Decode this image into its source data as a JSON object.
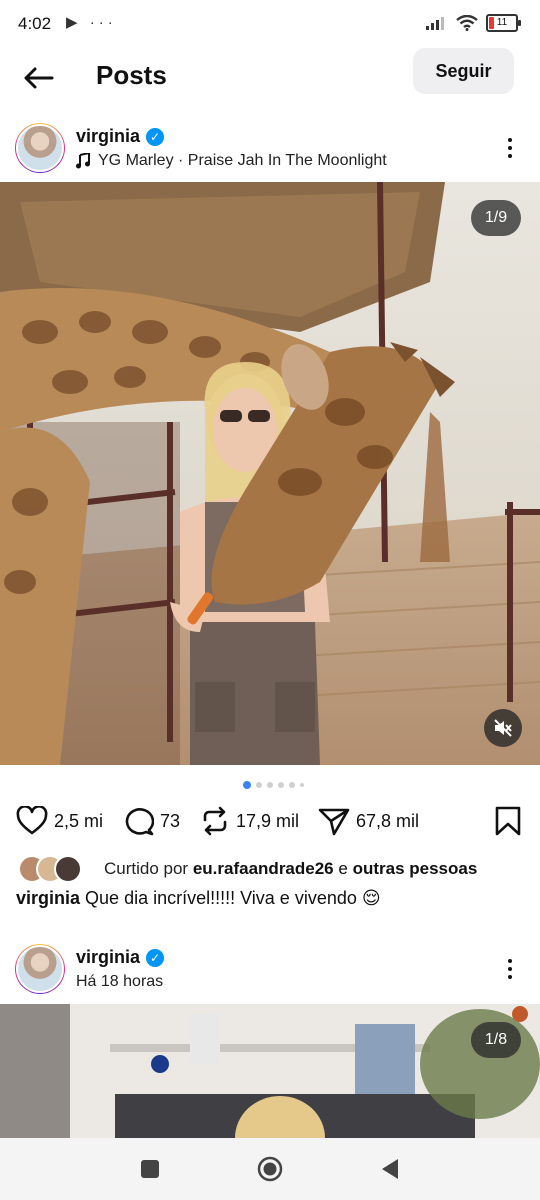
{
  "status": {
    "time": "4:02",
    "left_icons": "▶ ···",
    "battery": "11"
  },
  "header": {
    "title": "Posts",
    "follow_label": "Seguir"
  },
  "post1": {
    "username": "virginia",
    "music": "YG Marley · Praise Jah In The Moonlight",
    "counter": "1/9",
    "likes": "2,5 mi",
    "comments": "73",
    "reposts": "17,9 mil",
    "shares": "67,8 mil",
    "liked_by_prefix": "Curtido por",
    "liked_by_user": "eu.rafaandrade26",
    "liked_by_conj": "e",
    "liked_by_others": "outras pessoas",
    "caption_user": "virginia",
    "caption_text": "Que dia incrível!!!!! Viva e vivendo 😌"
  },
  "post2": {
    "username": "virginia",
    "time": "Há 18 horas",
    "counter": "1/8"
  },
  "icons": {
    "back": "back-arrow-icon",
    "verified": "verified-badge-icon",
    "music": "music-note-icon",
    "like": "heart-icon",
    "comment": "comment-icon",
    "repost": "repost-icon",
    "share": "send-icon",
    "save": "bookmark-icon",
    "mute": "muted-speaker-icon"
  },
  "colors": {
    "accent": "#0095f6",
    "carousel_active": "#3b82f6",
    "battery_low": "#e53935"
  }
}
